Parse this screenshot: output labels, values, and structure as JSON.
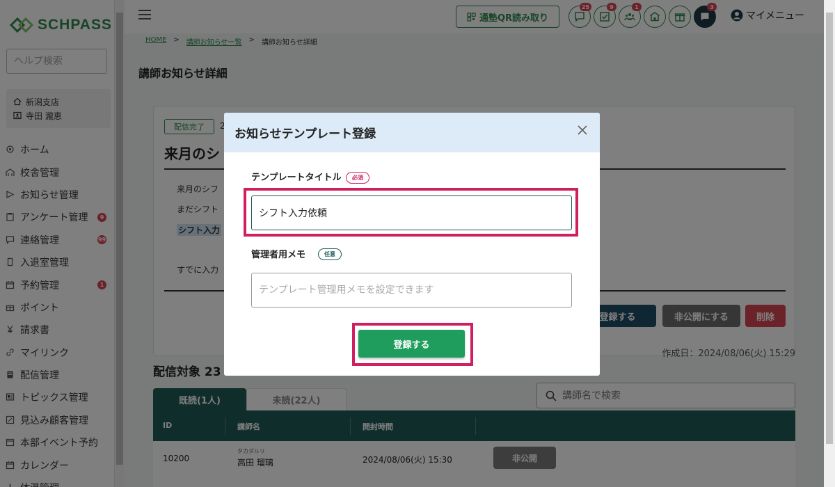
{
  "sidebar": {
    "logo_text": "SCHPASS",
    "help_placeholder": "ヘルプ検索",
    "school": "新潟支店",
    "user": "寺田 瀧恵",
    "items": [
      {
        "label": "ホーム",
        "icon": "gear-icon",
        "badge": ""
      },
      {
        "label": "校舎管理",
        "icon": "building-icon",
        "badge": ""
      },
      {
        "label": "お知らせ管理",
        "icon": "send-icon",
        "badge": ""
      },
      {
        "label": "アンケート管理",
        "icon": "clipboard-icon",
        "badge": "9"
      },
      {
        "label": "連絡管理",
        "icon": "chat-icon",
        "badge": "99"
      },
      {
        "label": "入退室管理",
        "icon": "door-icon",
        "badge": ""
      },
      {
        "label": "予約管理",
        "icon": "calendar-icon",
        "badge": "1"
      },
      {
        "label": "ポイント",
        "icon": "gift-icon",
        "badge": ""
      },
      {
        "label": "請求書",
        "icon": "yen-icon",
        "badge": ""
      },
      {
        "label": "マイリンク",
        "icon": "link-icon",
        "badge": ""
      },
      {
        "label": "配信管理",
        "icon": "doc-icon",
        "badge": ""
      },
      {
        "label": "トピックス管理",
        "icon": "news-icon",
        "badge": ""
      },
      {
        "label": "見込み顧客管理",
        "icon": "edit-icon",
        "badge": ""
      },
      {
        "label": "本部イベント予約",
        "icon": "calendar-icon",
        "badge": ""
      },
      {
        "label": "カレンダー",
        "icon": "calendar-icon",
        "badge": ""
      },
      {
        "label": "体温管理",
        "icon": "thermo-icon",
        "badge": ""
      }
    ]
  },
  "header": {
    "qr_label": "通塾QR読み取り",
    "icons": [
      {
        "name": "message-icon",
        "badge": "25"
      },
      {
        "name": "checklist-icon",
        "badge": "9"
      },
      {
        "name": "people-icon",
        "badge": "1"
      },
      {
        "name": "school-icon",
        "badge": ""
      },
      {
        "name": "gift-icon",
        "badge": ""
      },
      {
        "name": "chat-solid-icon",
        "badge": "3"
      }
    ],
    "mymenu": "マイメニュー"
  },
  "breadcrumb": {
    "home": "HOME",
    "list": "講師お知らせ一覧",
    "current": "講師お知らせ詳細"
  },
  "page_title": "講師お知らせ詳細",
  "notice": {
    "status": "配信完了",
    "date": "2",
    "title": "来月のシ",
    "body1": "来月のシフ",
    "body2": "まだシフト",
    "body3": "シフト入力",
    "body4": "すでに入力",
    "btn_template": "を登録する",
    "btn_private": "非公開にする",
    "btn_delete": "削除",
    "created": "作成日：2024/08/06(火) 15:29"
  },
  "delivery": {
    "title": "配信対象 23",
    "tab_read": "既読(1人)",
    "tab_unread": "未読(22人)",
    "search_placeholder": "講師名で検索",
    "columns": [
      "ID",
      "講師名",
      "開封時間"
    ],
    "rows": [
      {
        "id": "10200",
        "kana": "タカダルリ",
        "name": "高田 瑠璃",
        "opened": "2024/08/06(火) 15:30",
        "action": "非公開"
      }
    ]
  },
  "modal": {
    "title": "お知らせテンプレート登録",
    "title_label": "テンプレートタイトル",
    "required": "必須",
    "title_value": "シフト入力依頼",
    "memo_label": "管理者用メモ",
    "optional": "任意",
    "memo_placeholder": "テンプレート管理用メモを設定できます",
    "submit": "登録する"
  },
  "colors": {
    "brand": "#2f8a4c",
    "teal": "#1d5b57",
    "danger": "#d94452",
    "highlight": "#d01e5e"
  }
}
